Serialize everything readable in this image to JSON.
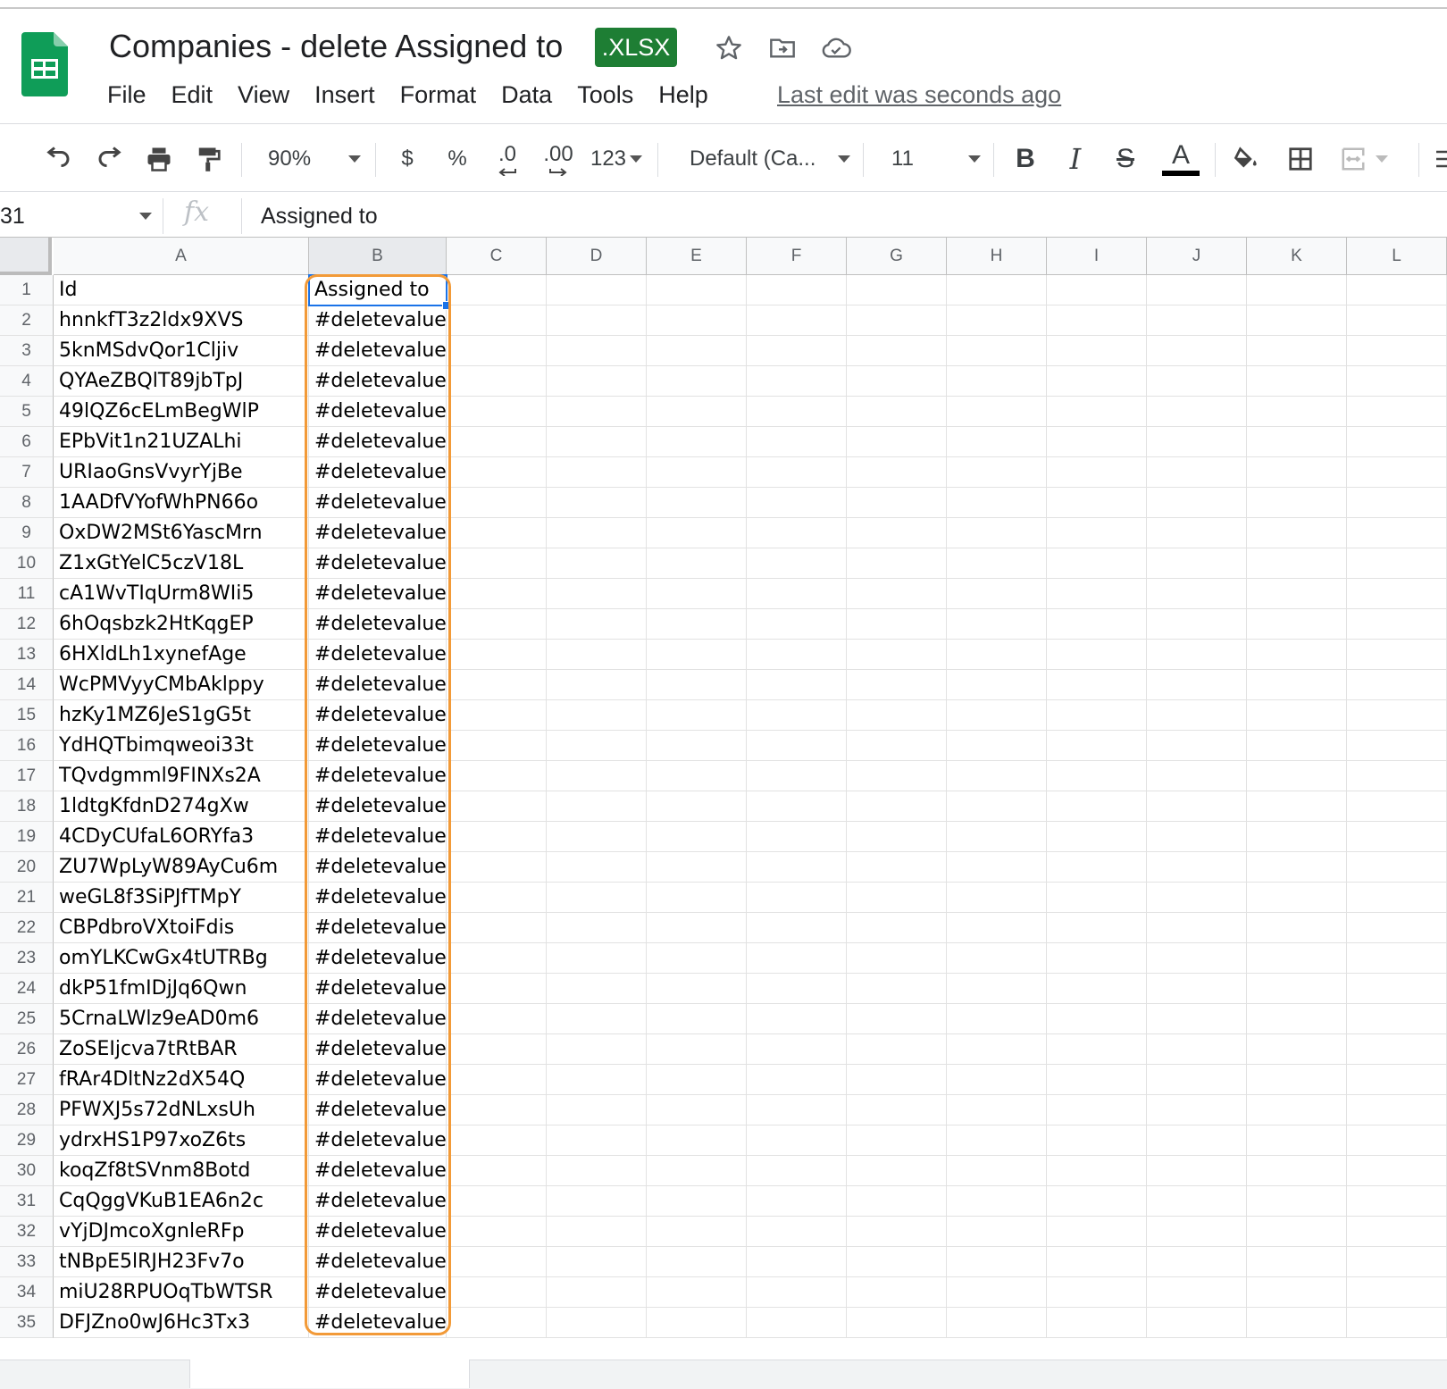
{
  "header": {
    "title": "Companies - delete Assigned to",
    "badge": ".XLSX",
    "last_edit": "Last edit was seconds ago",
    "icons": [
      "sheets-logo-icon",
      "star-icon",
      "move-to-folder-icon",
      "cloud-saved-icon"
    ]
  },
  "menu": [
    "File",
    "Edit",
    "View",
    "Insert",
    "Format",
    "Data",
    "Tools",
    "Help"
  ],
  "toolbar": {
    "zoom": "90%",
    "currency": "$",
    "percent": "%",
    "decrease_decimal": ".0",
    "increase_decimal": ".00",
    "more_formats": "123",
    "font": "Default (Ca...",
    "font_size": "11",
    "bold": "B",
    "italic": "I",
    "strike": "S",
    "text_color": "A"
  },
  "formula_bar": {
    "cell_ref": "31",
    "fx": "fx",
    "value": "Assigned to"
  },
  "grid": {
    "columns": [
      "A",
      "B",
      "C",
      "D",
      "E",
      "F",
      "G",
      "H",
      "I",
      "J",
      "K",
      "L"
    ],
    "selected_column": "B",
    "rows": [
      {
        "n": "1",
        "a": "Id",
        "b": "Assigned to"
      },
      {
        "n": "2",
        "a": "hnnkfT3z2ldx9XVS",
        "b": "#deletevalue"
      },
      {
        "n": "3",
        "a": "5knMSdvQor1Cljiv",
        "b": "#deletevalue"
      },
      {
        "n": "4",
        "a": "QYAeZBQlT89jbTpJ",
        "b": "#deletevalue"
      },
      {
        "n": "5",
        "a": "49lQZ6cELmBegWlP",
        "b": "#deletevalue"
      },
      {
        "n": "6",
        "a": "EPbVit1n21UZALhi",
        "b": "#deletevalue"
      },
      {
        "n": "7",
        "a": "URIaoGnsVvyrYjBe",
        "b": "#deletevalue"
      },
      {
        "n": "8",
        "a": "1AADfVYofWhPN66o",
        "b": "#deletevalue"
      },
      {
        "n": "9",
        "a": "OxDW2MSt6YascMrn",
        "b": "#deletevalue"
      },
      {
        "n": "10",
        "a": "Z1xGtYelC5czV18L",
        "b": "#deletevalue"
      },
      {
        "n": "11",
        "a": "cA1WvTIqUrm8WIi5",
        "b": "#deletevalue"
      },
      {
        "n": "12",
        "a": "6hOqsbzk2HtKqgEP",
        "b": "#deletevalue"
      },
      {
        "n": "13",
        "a": "6HXldLh1xynefAge",
        "b": "#deletevalue"
      },
      {
        "n": "14",
        "a": "WcPMVyyCMbAklppy",
        "b": "#deletevalue"
      },
      {
        "n": "15",
        "a": "hzKy1MZ6JeS1gG5t",
        "b": "#deletevalue"
      },
      {
        "n": "16",
        "a": "YdHQTbimqweoi33t",
        "b": "#deletevalue"
      },
      {
        "n": "17",
        "a": "TQvdgmml9FINXs2A",
        "b": "#deletevalue"
      },
      {
        "n": "18",
        "a": "1ldtgKfdnD274gXw",
        "b": "#deletevalue"
      },
      {
        "n": "19",
        "a": "4CDyCUfaL6ORYfa3",
        "b": "#deletevalue"
      },
      {
        "n": "20",
        "a": "ZU7WpLyW89AyCu6m",
        "b": "#deletevalue"
      },
      {
        "n": "21",
        "a": "weGL8f3SiPJfTMpY",
        "b": "#deletevalue"
      },
      {
        "n": "22",
        "a": "CBPdbroVXtoiFdis",
        "b": "#deletevalue"
      },
      {
        "n": "23",
        "a": "omYLKCwGx4tUTRBg",
        "b": "#deletevalue"
      },
      {
        "n": "24",
        "a": "dkP51fmIDjJq6Qwn",
        "b": "#deletevalue"
      },
      {
        "n": "25",
        "a": "5CrnaLWlz9eAD0m6",
        "b": "#deletevalue"
      },
      {
        "n": "26",
        "a": "ZoSEIjcva7tRtBAR",
        "b": "#deletevalue"
      },
      {
        "n": "27",
        "a": "fRAr4DltNz2dX54Q",
        "b": "#deletevalue"
      },
      {
        "n": "28",
        "a": "PFWXJ5s72dNLxsUh",
        "b": "#deletevalue"
      },
      {
        "n": "29",
        "a": "ydrxHS1P97xoZ6ts",
        "b": "#deletevalue"
      },
      {
        "n": "30",
        "a": "koqZf8tSVnm8Botd",
        "b": "#deletevalue"
      },
      {
        "n": "31",
        "a": "CqQggVKuB1EA6n2c",
        "b": "#deletevalue"
      },
      {
        "n": "32",
        "a": "vYjDJmcoXgnleRFp",
        "b": "#deletevalue"
      },
      {
        "n": "33",
        "a": "tNBpE5lRJH23Fv7o",
        "b": "#deletevalue"
      },
      {
        "n": "34",
        "a": "miU28RPUOqTbWTSR",
        "b": "#deletevalue"
      },
      {
        "n": "35",
        "a": "DFJZno0wJ6Hc3Tx3",
        "b": "#deletevalue"
      }
    ]
  },
  "colors": {
    "sheets_green": "#0f9d58",
    "badge_green": "#1e7e34",
    "selection_blue": "#1a73e8",
    "highlight_orange": "#f29a38"
  }
}
